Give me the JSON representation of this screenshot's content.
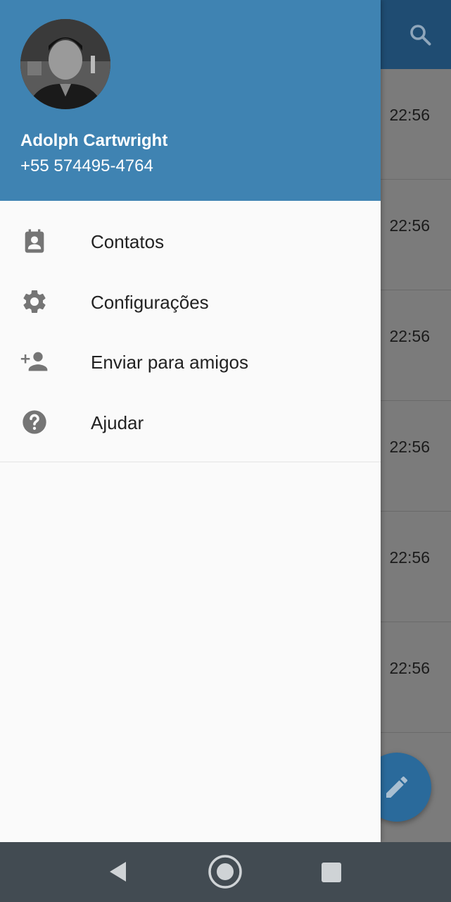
{
  "user": {
    "name": "Adolph Cartwright",
    "phone": "+55 574495-4764"
  },
  "menu": {
    "items": [
      {
        "label": "Contatos",
        "icon": "contacts-icon"
      },
      {
        "label": "Configurações",
        "icon": "settings-gear-icon"
      },
      {
        "label": "Enviar para amigos",
        "icon": "invite-friends-icon"
      },
      {
        "label": "Ajudar",
        "icon": "help-icon"
      }
    ]
  },
  "background_list": {
    "times": [
      "22:56",
      "22:56",
      "22:56",
      "22:56",
      "22:56",
      "22:56"
    ]
  },
  "colors": {
    "header": "#3f83b2",
    "toolbar": "#1f4c72",
    "fab": "#2a6a9b",
    "navbar": "#424b52"
  }
}
